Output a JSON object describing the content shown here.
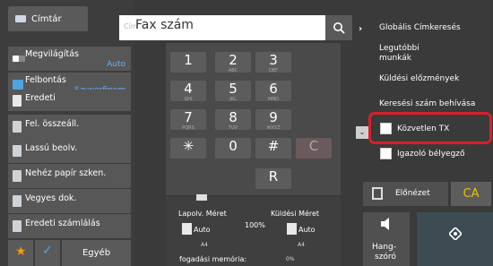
{
  "colors": {
    "accent_blue": "#6ab0f0",
    "highlight_red": "#d6202a",
    "ca_yellow": "#f0c000",
    "star_orange": "#f39a1a"
  },
  "left": {
    "directory_label": "Címtár",
    "buttons": [
      {
        "label": "Megvilágítás",
        "value": "Auto",
        "icon": "contrast-icon"
      },
      {
        "label": "Felbontás",
        "value": "Szuperfinom",
        "icon": "resolution-icon"
      },
      {
        "label": "Eredeti",
        "value": "",
        "icon": "original-icon"
      },
      {
        "label": "Fel. összeáll.",
        "value": "",
        "icon": "batch-icon"
      },
      {
        "label": "Lassú beolv.",
        "value": "",
        "icon": "slow-scan-icon"
      },
      {
        "label": "Nehéz papír szken.",
        "value": "",
        "icon": "heavy-paper-icon"
      },
      {
        "label": "Vegyes dok.",
        "value": "",
        "icon": "mixed-doc-icon"
      },
      {
        "label": "Eredeti számlálás",
        "value": "",
        "icon": "count-icon"
      }
    ],
    "other_label": "Egyéb"
  },
  "search": {
    "prefix": "Cím",
    "placeholder": "Fax szám"
  },
  "keypad": [
    {
      "n": "1",
      "s": ""
    },
    {
      "n": "2",
      "s": "ABC"
    },
    {
      "n": "3",
      "s": "DEF"
    },
    {
      "n": "4",
      "s": "GHI"
    },
    {
      "n": "5",
      "s": "JKL"
    },
    {
      "n": "6",
      "s": "MNO"
    },
    {
      "n": "7",
      "s": "PQRS"
    },
    {
      "n": "8",
      "s": "TUV"
    },
    {
      "n": "9",
      "s": "WXYZ"
    },
    {
      "n": "✳",
      "s": ""
    },
    {
      "n": "0",
      "s": ""
    },
    {
      "n": "#",
      "s": ""
    },
    {
      "n": "C",
      "s": ""
    },
    {
      "n": "R",
      "s": ""
    }
  ],
  "status": {
    "orig_size_label": "Lapolv. Méret",
    "send_size_label": "Küldési Méret",
    "percent": "100%",
    "orig_auto": "Auto",
    "send_auto": "Auto",
    "orig_paper": "A4",
    "send_paper": "A4",
    "memory_label": "fogadási memória:",
    "memory_value": "0%"
  },
  "right": {
    "global_search": "Globális Címkeresés",
    "recent_line1": "Legutóbbi",
    "recent_line2": "munkák",
    "send_history": "Küldési előzmények",
    "call_search": "Keresési szám behívása",
    "direct_tx": "Közvetlen TX",
    "verify_stamp": "Igazoló bélyegző",
    "preview": "Előnézet",
    "ca": "CA",
    "speaker_line1": "Hang-",
    "speaker_line2": "szóró"
  }
}
